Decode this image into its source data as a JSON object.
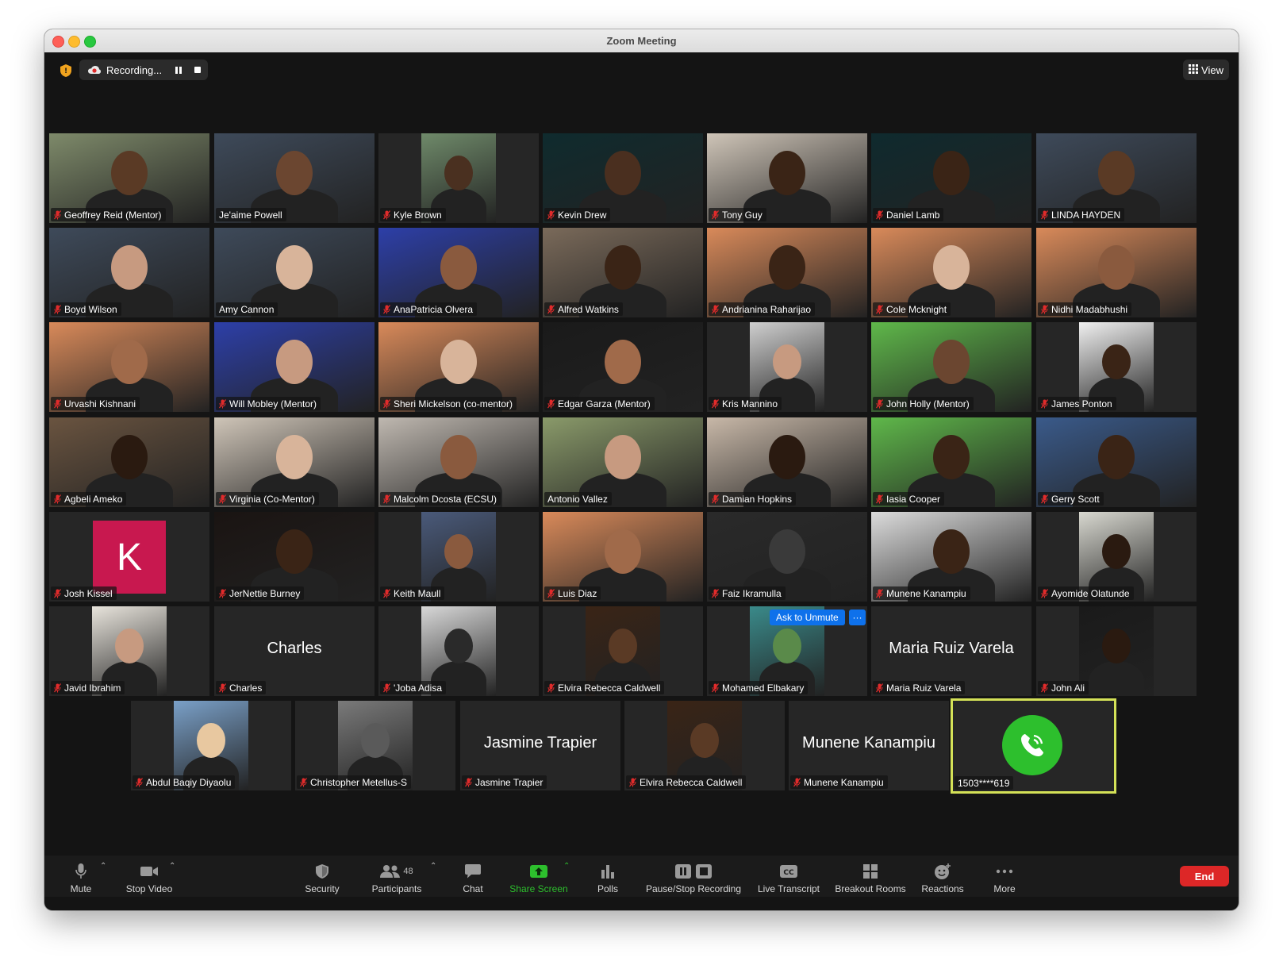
{
  "window": {
    "title": "Zoom Meeting"
  },
  "header": {
    "recording_label": "Recording...",
    "view_label": "View"
  },
  "colors": {
    "accent_green": "#2dbf2d",
    "end_red": "#dd2727",
    "highlight": "#d4e157",
    "unmute_blue": "#0e71eb"
  },
  "participants": [
    {
      "name": "Geoffrey Reid (Mentor)",
      "row": 0,
      "col": 0,
      "bg": "#7e8a6a",
      "skin": "#5a3a25"
    },
    {
      "name": "Je'aime Powell",
      "row": 0,
      "col": 1,
      "bg": "#3e4a5a",
      "skin": "#6b4630",
      "mic_on": true
    },
    {
      "name": "Kyle Brown",
      "row": 0,
      "col": 2,
      "bg": "#6f8a6a",
      "skin": "#4a3020",
      "small": true
    },
    {
      "name": "Kevin Drew",
      "row": 0,
      "col": 3,
      "bg": "#0f2b2e",
      "skin": "#4a2f1f"
    },
    {
      "name": "Tony Guy",
      "row": 0,
      "col": 4,
      "bg": "#cfc5b8",
      "skin": "#3a2416"
    },
    {
      "name": "Daniel Lamb",
      "row": 0,
      "col": 5,
      "bg": "#0f2a2e",
      "skin": "#3a2416"
    },
    {
      "name": "LINDA HAYDEN",
      "row": 0,
      "col": 6,
      "bg": "#3e4a5a",
      "skin": "#5a3a25"
    },
    {
      "name": "Boyd Wilson",
      "row": 1,
      "col": 0,
      "bg": "#3e4a5a",
      "skin": "#c79a80"
    },
    {
      "name": "Amy Cannon",
      "row": 1,
      "col": 1,
      "bg": "#3e4a5a",
      "skin": "#d8b49a",
      "mic_on": true
    },
    {
      "name": "AnaPatricia Olvera",
      "row": 1,
      "col": 2,
      "bg": "#2d3fa8",
      "skin": "#8a5a3e"
    },
    {
      "name": "Alfred Watkins",
      "row": 1,
      "col": 3,
      "bg": "#7a6a5a",
      "skin": "#3a2416"
    },
    {
      "name": "Andrianina Raharijao",
      "row": 1,
      "col": 4,
      "bg": "#d98a5a",
      "skin": "#3a2416"
    },
    {
      "name": "Cole Mcknight",
      "row": 1,
      "col": 5,
      "bg": "#d98a5a",
      "skin": "#d8b49a"
    },
    {
      "name": "Nidhi Madabhushi",
      "row": 1,
      "col": 6,
      "bg": "#d98a5a",
      "skin": "#8a5a3e"
    },
    {
      "name": "Urvashi Kishnani",
      "row": 2,
      "col": 0,
      "bg": "#d98a5a",
      "skin": "#a06a4a"
    },
    {
      "name": "Will Mobley (Mentor)",
      "row": 2,
      "col": 1,
      "bg": "#2d3fa8",
      "skin": "#c79a80"
    },
    {
      "name": "Sheri Mickelson (co-mentor)",
      "row": 2,
      "col": 2,
      "bg": "#d98a5a",
      "skin": "#d8b49a"
    },
    {
      "name": "Edgar Garza (Mentor)",
      "row": 2,
      "col": 3,
      "bg": "#1a1a1a",
      "skin": "#a06a4a"
    },
    {
      "name": "Kris Mannino",
      "row": 2,
      "col": 4,
      "bg": "#cfcfcf",
      "skin": "#c79a80",
      "small": true
    },
    {
      "name": "John Holly (Mentor)",
      "row": 2,
      "col": 5,
      "bg": "#5fb84a",
      "skin": "#6b4630"
    },
    {
      "name": "James Ponton",
      "row": 2,
      "col": 6,
      "bg": "#f0f0f0",
      "skin": "#3a2416",
      "small": true
    },
    {
      "name": "Agbeli Ameko",
      "row": 3,
      "col": 0,
      "bg": "#6a5440",
      "skin": "#2a1a10"
    },
    {
      "name": "Virginia (Co-Mentor)",
      "row": 3,
      "col": 1,
      "bg": "#cfc5b8",
      "skin": "#d8b49a"
    },
    {
      "name": "Malcolm Dcosta (ECSU)",
      "row": 3,
      "col": 2,
      "bg": "#bfb8b0",
      "skin": "#8a5a3e"
    },
    {
      "name": "Antonio Vallez",
      "row": 3,
      "col": 3,
      "bg": "#8a9a6a",
      "skin": "#c79a80",
      "mic_on": true
    },
    {
      "name": "Damian Hopkins",
      "row": 3,
      "col": 4,
      "bg": "#c8b8a8",
      "skin": "#2a1a10"
    },
    {
      "name": "Iasia Cooper",
      "row": 3,
      "col": 5,
      "bg": "#5fb84a",
      "skin": "#3a2416"
    },
    {
      "name": "Gerry Scott",
      "row": 3,
      "col": 6,
      "bg": "#3a5a8a",
      "skin": "#3a2416"
    },
    {
      "name": "Josh Kissel",
      "row": 4,
      "col": 0,
      "avatar": "K"
    },
    {
      "name": "JerNettie Burney",
      "row": 4,
      "col": 1,
      "bg": "#1a1412",
      "skin": "#3a2416"
    },
    {
      "name": "Keith Maull",
      "row": 4,
      "col": 2,
      "bg": "#4a5a7a",
      "skin": "#8a5a3e",
      "small": true
    },
    {
      "name": "Luis Diaz",
      "row": 4,
      "col": 3,
      "bg": "#d98a5a",
      "skin": "#a06a4a"
    },
    {
      "name": "Faiz Ikramulla",
      "row": 4,
      "col": 4,
      "bg": "#2a2a2a",
      "skin": "#3a3a3a"
    },
    {
      "name": "Munene Kanampiu",
      "row": 4,
      "col": 5,
      "bg": "#dcdcdc",
      "skin": "#3a2416"
    },
    {
      "name": "Ayomide Olatunde",
      "row": 4,
      "col": 6,
      "bg": "#d8d8d0",
      "skin": "#2a1a10",
      "small": true
    },
    {
      "name": "Javid Ibrahim",
      "row": 5,
      "col": 0,
      "bg": "#e8e4dc",
      "skin": "#c79a80",
      "small": true
    },
    {
      "name": "Charles",
      "row": 5,
      "col": 1,
      "bigname": "Charles"
    },
    {
      "name": "'Joba Adisa",
      "row": 5,
      "col": 2,
      "bg": "#d8d8d8",
      "skin": "#2a2a2a",
      "small": true
    },
    {
      "name": "Elvira Rebecca Caldwell",
      "row": 5,
      "col": 3,
      "bg": "#3a2416",
      "skin": "#5a3a25",
      "small": true
    },
    {
      "name": "Mohamed Elbakary",
      "row": 5,
      "col": 4,
      "bg": "#3a8a8a",
      "skin": "#5a8a4a",
      "small": true,
      "unmute": true
    },
    {
      "name": "Maria Ruiz Varela",
      "row": 5,
      "col": 5,
      "bigname": "Maria Ruiz Varela"
    },
    {
      "name": "John Ali",
      "row": 5,
      "col": 6,
      "bg": "#1a1a1a",
      "skin": "#2a1a10",
      "small": true
    },
    {
      "name": "Abdul Baqiy Diyaolu",
      "row": 6,
      "col": 0,
      "bg": "#7aa0c8",
      "skin": "#e8c8a0",
      "small": true
    },
    {
      "name": "Christopher Metellus-S",
      "row": 6,
      "col": 1,
      "bg": "#7a7a7a",
      "skin": "#5a5a5a",
      "small": true
    },
    {
      "name": "Jasmine Trapier",
      "row": 6,
      "col": 2,
      "bigname": "Jasmine Trapier"
    },
    {
      "name": "Elvira Rebecca Caldwell",
      "row": 6,
      "col": 3,
      "bg": "#3a2416",
      "skin": "#5a3a25",
      "small": true
    },
    {
      "name": "Munene Kanampiu",
      "row": 6,
      "col": 4,
      "bigname": "Munene Kanampiu"
    },
    {
      "name": "1503****619",
      "row": 6,
      "col": 5,
      "phone": true
    }
  ],
  "unmute": {
    "ask_label": "Ask to Unmute",
    "more_label": "···"
  },
  "toolbar": {
    "mute": "Mute",
    "stop_video": "Stop Video",
    "security": "Security",
    "participants": "Participants",
    "participant_count": "48",
    "chat": "Chat",
    "share_screen": "Share Screen",
    "polls": "Polls",
    "pause_stop_recording": "Pause/Stop Recording",
    "live_transcript": "Live Transcript",
    "breakout_rooms": "Breakout Rooms",
    "reactions": "Reactions",
    "more": "More",
    "end": "End"
  }
}
